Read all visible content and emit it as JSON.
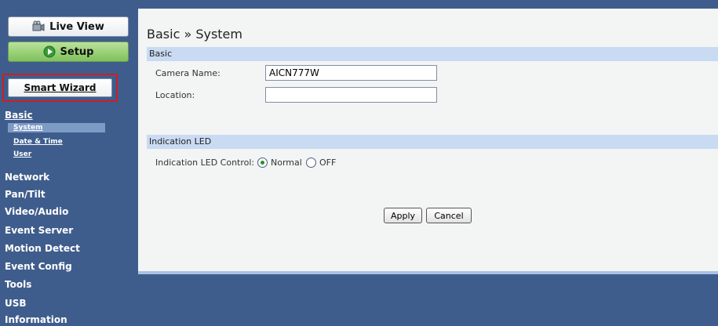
{
  "sidebar": {
    "live_view_label": "Live View",
    "setup_label": "Setup",
    "smart_wizard_label": "Smart Wizard",
    "sections": {
      "basic": "Basic",
      "basic_items": [
        "System",
        "Date & Time",
        "User"
      ],
      "network": "Network",
      "pan_tilt": "Pan/Tilt",
      "video_audio": "Video/Audio",
      "event_server": "Event Server",
      "motion_detect": "Motion Detect",
      "event_config": "Event Config",
      "tools": "Tools",
      "usb": "USB",
      "information": "Information"
    }
  },
  "main": {
    "page_title": "Basic » System",
    "basic_section": {
      "title": "Basic",
      "camera_name_label": "Camera Name:",
      "camera_name_value": "AICN777W",
      "location_label": "Location:",
      "location_value": ""
    },
    "led_section": {
      "title": "Indication LED",
      "control_label": "Indication LED Control:",
      "options": [
        "Normal",
        "OFF"
      ],
      "selected": "Normal"
    },
    "buttons": {
      "apply": "Apply",
      "cancel": "Cancel"
    }
  },
  "colors": {
    "sidebar_bg": "#3f5d8c",
    "section_bar": "#c9daf3",
    "wizard_highlight": "#cc1f24",
    "setup_green": "#7fc15c"
  }
}
